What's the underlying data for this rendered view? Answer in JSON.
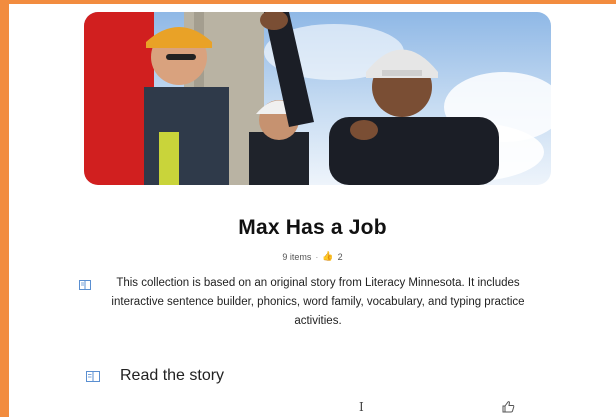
{
  "collection": {
    "title": "Max Has a Job",
    "items_count": "9 items",
    "separator": "·",
    "likes": "2",
    "like_icon": "thumbs-up-icon",
    "description": "This collection is based on an original story from Literacy Minnesota. It includes interactive sentence builder, phonics, word family, vocabulary, and typing practice activities."
  },
  "sections": [
    {
      "label": "Read the story",
      "icon": "book-icon"
    }
  ],
  "colors": {
    "frame": "#f28c3f",
    "hero_accent": "#d11f1f",
    "text": "#111111"
  }
}
